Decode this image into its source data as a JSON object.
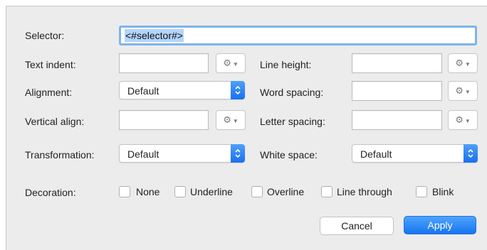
{
  "dialog": {
    "selector": {
      "label": "Selector:",
      "value": "<#selector#>"
    },
    "text_indent": {
      "label": "Text indent:",
      "value": ""
    },
    "line_height": {
      "label": "Line height:",
      "value": ""
    },
    "alignment": {
      "label": "Alignment:",
      "selected": "Default"
    },
    "word_spacing": {
      "label": "Word spacing:",
      "value": ""
    },
    "vertical_align": {
      "label": "Vertical align:",
      "value": ""
    },
    "letter_spacing": {
      "label": "Letter spacing:",
      "value": ""
    },
    "transformation": {
      "label": "Transformation:",
      "selected": "Default"
    },
    "white_space": {
      "label": "White space:",
      "selected": "Default"
    },
    "decoration": {
      "label": "Decoration:",
      "options": [
        "None",
        "Underline",
        "Overline",
        "Line through",
        "Blink"
      ]
    },
    "buttons": {
      "cancel": "Cancel",
      "apply": "Apply"
    }
  },
  "icons": {
    "gear": "gear-icon",
    "dropdown_caret": "caret-down-icon",
    "stepper": "updown-chevron-icon"
  },
  "colors": {
    "accent": "#1a73f0",
    "focus_ring": "#7eb4ea",
    "selection": "#b3d4fd",
    "dialog_bg": "#ececec"
  }
}
